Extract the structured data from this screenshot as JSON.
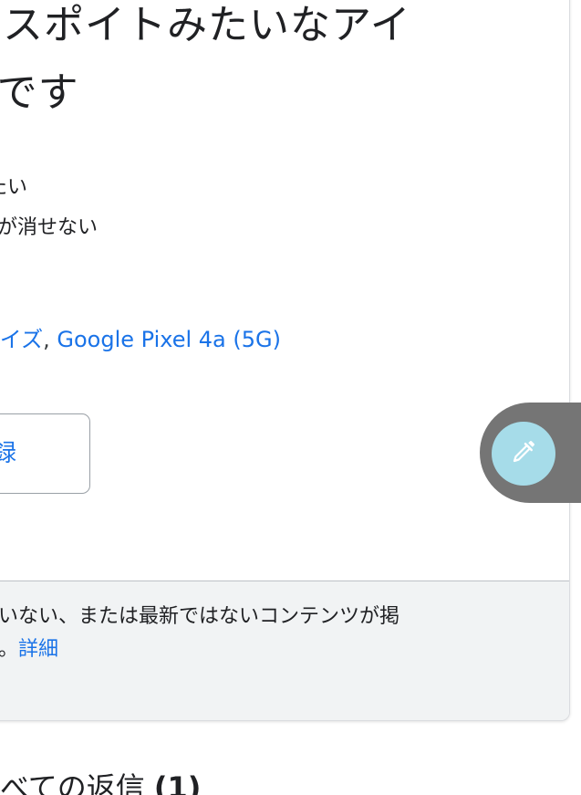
{
  "post": {
    "title_line1": "スポイトみたいなアイ",
    "title_line2": "いです",
    "body_line1": "たい",
    "body_line2": "るが消せない"
  },
  "meta": {
    "link1": "アイズ",
    "separator": ",",
    "link2": "Google Pixel 4a (5G)"
  },
  "follow_button": {
    "label": "録"
  },
  "notice": {
    "line1": "いない、または最新ではないコンテンツが掲",
    "line2_prefix": "。",
    "detail_link": "詳細"
  },
  "replies": {
    "heading": "べての返信",
    "count": "(1)"
  },
  "floating_button": {
    "icon": "eyedropper-icon",
    "color": "#a6dce9",
    "tab_color": "#757575"
  },
  "colors": {
    "link": "#1a73e8",
    "notice_bg": "#f1f3f4"
  }
}
